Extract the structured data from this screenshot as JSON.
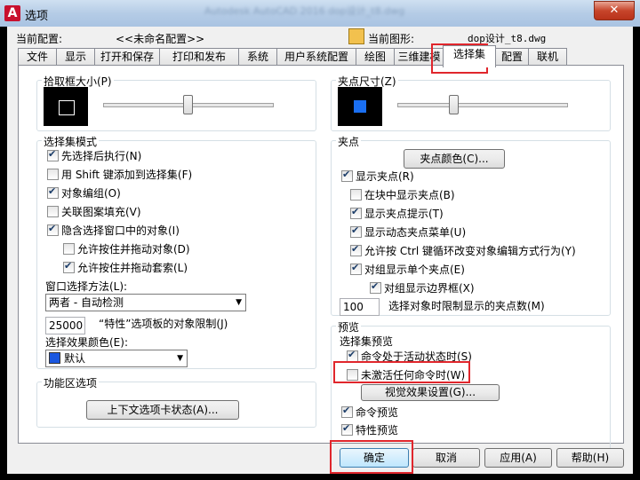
{
  "window": {
    "title": "选项",
    "blurred_title": "Autodesk AutoCAD 2016   dop设计_t8.dwg",
    "close_label": "✕"
  },
  "profile": {
    "label": "当前配置:",
    "value": "<<未命名配置>>",
    "drawing_label": "当前图形:",
    "drawing_value": "dop设计_t8.dwg"
  },
  "tabs": [
    "文件",
    "显示",
    "打开和保存",
    "打印和发布",
    "系统",
    "用户系统配置",
    "绘图",
    "三维建模",
    "选择集",
    "配置",
    "联机"
  ],
  "active_tab": "选择集",
  "pickbox": {
    "title": "拾取框大小(P)",
    "slider_fraction": 0.5
  },
  "grip_size": {
    "title": "夹点尺寸(Z)",
    "slider_fraction": 0.33,
    "color": "#1a6ff2"
  },
  "selection_modes": {
    "title": "选择集模式",
    "items": [
      {
        "label": "先选择后执行(N)",
        "checked": true
      },
      {
        "label": "用 Shift 键添加到选择集(F)",
        "checked": false
      },
      {
        "label": "对象编组(O)",
        "checked": true
      },
      {
        "label": "关联图案填充(V)",
        "checked": false
      },
      {
        "label": "隐含选择窗口中的对象(I)",
        "checked": true
      },
      {
        "label": "允许按住并拖动对象(D)",
        "checked": false
      },
      {
        "label": "允许按住并拖动套索(L)",
        "checked": true
      }
    ],
    "window_method_label": "窗口选择方法(L):",
    "window_method_value": "两者 - 自动检测",
    "limit_value": "25000",
    "limit_label": "“特性”选项板的对象限制(J)",
    "effect_color_label": "选择效果颜色(E):",
    "effect_color_value": "默认"
  },
  "ribbon": {
    "title": "功能区选项",
    "button": "上下文选项卡状态(A)..."
  },
  "grips": {
    "title": "夹点",
    "color_button": "夹点颜色(C)...",
    "items": [
      {
        "label": "显示夹点(R)",
        "checked": true
      },
      {
        "label": "在块中显示夹点(B)",
        "checked": false
      },
      {
        "label": "显示夹点提示(T)",
        "checked": true
      },
      {
        "label": "显示动态夹点菜单(U)",
        "checked": true
      },
      {
        "label": "允许按 Ctrl 键循环改变对象编辑方式行为(Y)",
        "checked": true
      },
      {
        "label": "对组显示单个夹点(E)",
        "checked": true
      },
      {
        "label": "对组显示边界框(X)",
        "checked": true
      }
    ],
    "limit_value": "100",
    "limit_label": "选择对象时限制显示的夹点数(M)"
  },
  "preview": {
    "title": "预览",
    "subtitle": "选择集预览",
    "items": [
      {
        "label": "命令处于活动状态时(S)",
        "checked": true
      },
      {
        "label": "未激活任何命令时(W)",
        "checked": false
      }
    ],
    "effects_button": "视觉效果设置(G)...",
    "extra": [
      {
        "label": "命令预览",
        "checked": true
      },
      {
        "label": "特性预览",
        "checked": true
      }
    ]
  },
  "footer": {
    "ok": "确定",
    "cancel": "取消",
    "apply": "应用(A)",
    "help": "帮助(H)"
  }
}
